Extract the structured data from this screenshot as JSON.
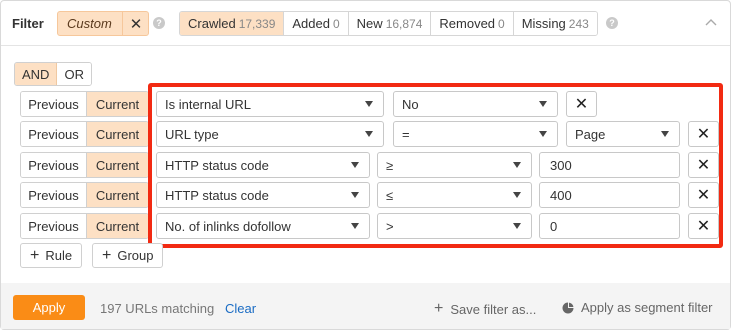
{
  "header": {
    "title": "Filter",
    "custom_label": "Custom",
    "custom_close": "✕",
    "help": "?",
    "tabs": [
      {
        "label": "Crawled",
        "count": "17,339"
      },
      {
        "label": "Added",
        "count": "0"
      },
      {
        "label": "New",
        "count": "16,874"
      },
      {
        "label": "Removed",
        "count": "0"
      },
      {
        "label": "Missing",
        "count": "243"
      }
    ],
    "active_tab": "Crawled",
    "collapse_glyph": "^"
  },
  "logic": {
    "and": "AND",
    "or": "OR",
    "selected": "AND"
  },
  "rows": [
    {
      "prev": "Previous",
      "cur": "Current",
      "field": "Is internal URL",
      "operator": "No",
      "value": "",
      "remove": "✕"
    },
    {
      "prev": "Previous",
      "cur": "Current",
      "field": "URL type",
      "operator": "=",
      "value": "Page",
      "remove": "✕"
    },
    {
      "prev": "Previous",
      "cur": "Current",
      "field": "HTTP status code",
      "operator": "≥",
      "value": "300",
      "remove": "✕"
    },
    {
      "prev": "Previous",
      "cur": "Current",
      "field": "HTTP status code",
      "operator": "≤",
      "value": "400",
      "remove": "✕"
    },
    {
      "prev": "Previous",
      "cur": "Current",
      "field": "No. of inlinks dofollow",
      "operator": ">",
      "value": "0",
      "remove": "✕"
    }
  ],
  "add": {
    "plus": "+",
    "rule": "Rule",
    "group": "Group"
  },
  "footer": {
    "apply": "Apply",
    "matching": "197 URLs matching",
    "clear": "Clear",
    "save_filter": "Save filter as...",
    "apply_segment": "Apply as segment filter"
  },
  "colors": {
    "accent": "#fa8c16",
    "selected_bg": "#fde0c4",
    "highlight_border": "#f22a12",
    "link": "#1a6cc4"
  }
}
